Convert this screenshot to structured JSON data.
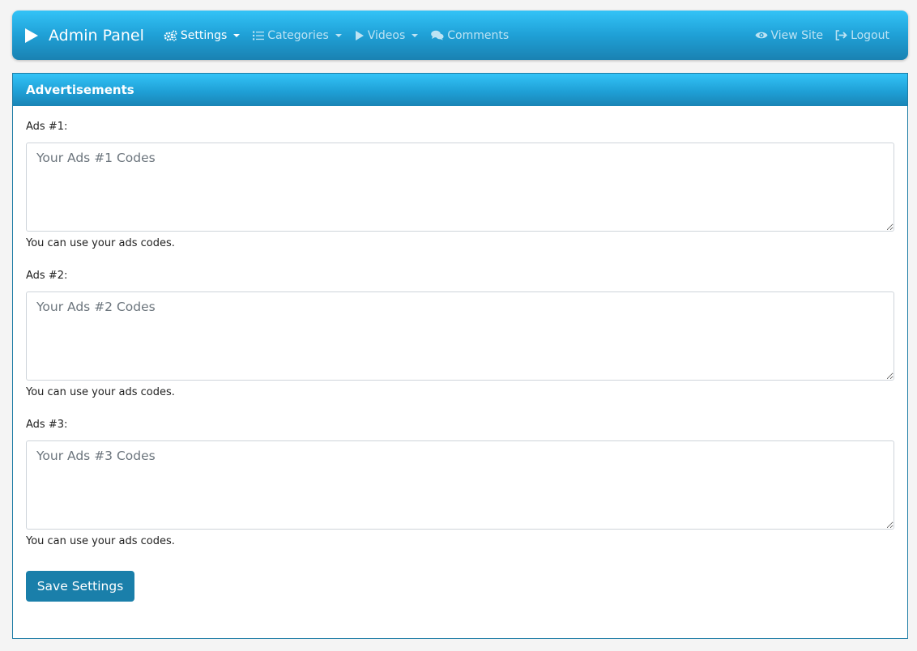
{
  "navbar": {
    "brand": "Admin Panel",
    "items": [
      {
        "label": "Settings",
        "icon": "gears-icon",
        "dropdown": true,
        "active": true
      },
      {
        "label": "Categories",
        "icon": "list-icon",
        "dropdown": true
      },
      {
        "label": "Videos",
        "icon": "play-icon",
        "dropdown": true
      },
      {
        "label": "Comments",
        "icon": "comments-icon",
        "dropdown": false
      }
    ],
    "right_items": [
      {
        "label": "View Site",
        "icon": "eye-icon"
      },
      {
        "label": "Logout",
        "icon": "logout-icon"
      }
    ]
  },
  "panel": {
    "title": "Advertisements",
    "ads": [
      {
        "label": "Ads #1:",
        "placeholder": "Your Ads #1 Codes",
        "value": "",
        "help": "You can use your ads codes."
      },
      {
        "label": "Ads #2:",
        "placeholder": "Your Ads #2 Codes",
        "value": "",
        "help": "You can use your ads codes."
      },
      {
        "label": "Ads #3:",
        "placeholder": "Your Ads #3 Codes",
        "value": "",
        "help": "You can use your ads codes."
      }
    ],
    "save_label": "Save Settings"
  },
  "colors": {
    "navbar_gradient_top": "#33c3f7",
    "navbar_gradient_bottom": "#1a82b2",
    "button": "#1a7faa",
    "panel_border": "#1e7da6"
  }
}
